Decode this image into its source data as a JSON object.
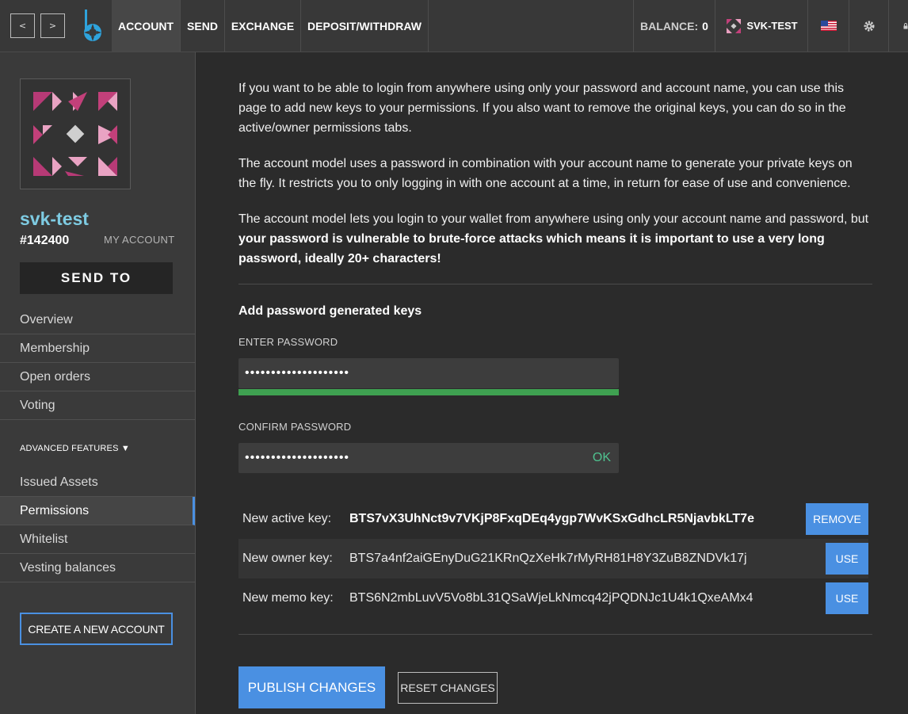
{
  "nav": {
    "back_label": "<",
    "forward_label": ">"
  },
  "menu": [
    {
      "label": "ACCOUNT"
    },
    {
      "label": "SEND"
    },
    {
      "label": "EXCHANGE"
    },
    {
      "label": "DEPOSIT/WITHDRAW"
    }
  ],
  "header": {
    "balance_label": "BALANCE:",
    "balance_value": "0",
    "account_label": "SVK-TEST"
  },
  "sidebar": {
    "account_name": "svk-test",
    "account_id": "#142400",
    "my_account_label": "MY ACCOUNT",
    "send_to_label": "SEND TO",
    "items": [
      {
        "label": "Overview"
      },
      {
        "label": "Membership"
      },
      {
        "label": "Open orders"
      },
      {
        "label": "Voting"
      }
    ],
    "advanced_label": "ADVANCED FEATURES ▼",
    "advanced_items": [
      {
        "label": "Issued Assets"
      },
      {
        "label": "Permissions"
      },
      {
        "label": "Whitelist"
      },
      {
        "label": "Vesting balances"
      }
    ],
    "create_account_label": "CREATE A NEW ACCOUNT"
  },
  "main": {
    "para1": "If you want to be able to login from anywhere using only your password and account name, you can use this page to add new keys to your permissions. If you also want to remove the original keys, you can do so in the active/owner permissions tabs.",
    "para2": "The account model uses a password in combination with your account name to generate your private keys on the fly. It restricts you to only logging in with one account at a time, in return for ease of use and convenience.",
    "para3_normal": "The account model lets you login to your wallet from anywhere using only your account name and password, but ",
    "para3_bold": "your password is vulnerable to brute-force attacks which means it is important to use a very long password, ideally 20+ characters!",
    "section_title": "Add password generated keys",
    "enter_password_label": "ENTER PASSWORD",
    "enter_password_value": "••••••••••••••••••••",
    "password_strength": 1.0,
    "confirm_password_label": "CONFIRM PASSWORD",
    "confirm_password_value": "••••••••••••••••••••",
    "confirm_status": "OK",
    "keys": [
      {
        "label": "New active key:",
        "value": "BTS7vX3UhNct9v7VKjP8FxqDEq4ygp7WvKSxGdhcLR5NjavbkLT7e",
        "button": "REMOVE"
      },
      {
        "label": "New owner key:",
        "value": "BTS7a4nf2aiGEnyDuG21KRnQzXeHk7rMyRH81H8Y3ZuB8ZNDVk17j",
        "button": "USE"
      },
      {
        "label": "New memo key:",
        "value": "BTS6N2mbLuvV5Vo8bL31QSaWjeLkNmcq42jPQDNJc1U4k1QxeAMx4",
        "button": "USE"
      }
    ],
    "publish_label": "PUBLISH CHANGES",
    "reset_label": "RESET CHANGES"
  },
  "colors": {
    "accent": "#4a90e2",
    "account_name": "#7ecbe2",
    "ok": "#4fc28f",
    "strength": "#3fa151"
  }
}
